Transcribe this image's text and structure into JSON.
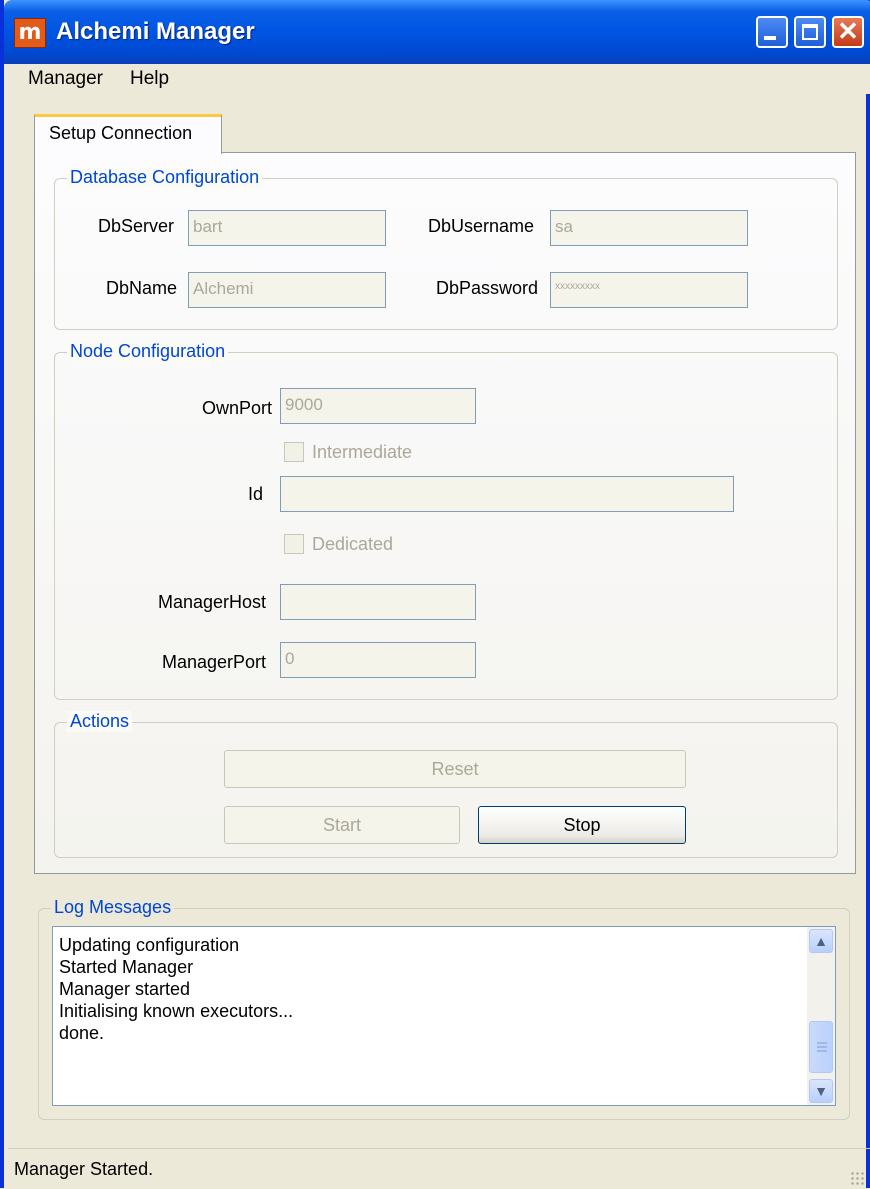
{
  "window": {
    "title": "Alchemi Manager",
    "icon": "m-app-icon"
  },
  "menu": [
    "Manager",
    "Help"
  ],
  "tabs": [
    {
      "label": "Setup Connection",
      "selected": true
    }
  ],
  "database": {
    "title": "Database Configuration",
    "server_label": "DbServer",
    "server_value": "bart",
    "name_label": "DbName",
    "name_value": "Alchemi",
    "username_label": "DbUsername",
    "username_value": "sa",
    "password_label": "DbPassword",
    "password_value": "xxxxxxxxx"
  },
  "node": {
    "title": "Node Configuration",
    "ownport_label": "OwnPort",
    "ownport_value": "9000",
    "intermediate_label": "Intermediate",
    "intermediate_checked": false,
    "id_label": "Id",
    "id_value": "",
    "dedicated_label": "Dedicated",
    "dedicated_checked": false,
    "managerhost_label": "ManagerHost",
    "managerhost_value": "",
    "managerport_label": "ManagerPort",
    "managerport_value": "0"
  },
  "actions": {
    "title": "Actions",
    "reset_label": "Reset",
    "start_label": "Start",
    "stop_label": "Stop"
  },
  "log": {
    "title": "Log Messages",
    "lines": [
      "Updating configuration",
      "Started Manager",
      "Manager started",
      "Initialising known executors...",
      "done."
    ]
  },
  "status": {
    "text": "Manager Started."
  }
}
